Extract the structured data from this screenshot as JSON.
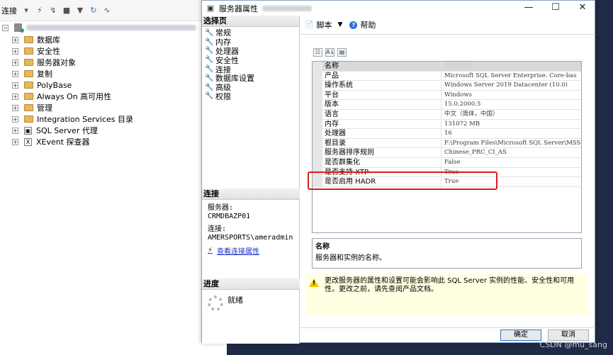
{
  "object_explorer": {
    "toolbar_label": "连接",
    "tree": [
      {
        "label": "数据库"
      },
      {
        "label": "安全性"
      },
      {
        "label": "服务器对象"
      },
      {
        "label": "复制"
      },
      {
        "label": "PolyBase"
      },
      {
        "label": "Always On 高可用性"
      },
      {
        "label": "管理"
      },
      {
        "label": "Integration Services 目录"
      },
      {
        "label": "SQL Server 代理"
      },
      {
        "label": "XEvent 探查器"
      }
    ]
  },
  "dialog": {
    "title": "服务器属性",
    "page_section_title": "选择页",
    "pages": [
      "常规",
      "内存",
      "处理器",
      "安全性",
      "连接",
      "数据库设置",
      "高级",
      "权限"
    ],
    "connection": {
      "section_title": "连接",
      "server_label": "服务器:",
      "server_value": "CRMDBAZP01",
      "connect_label": "连接:",
      "connect_value": "AMERSPORTS\\ameradmin",
      "link_text": "查看连接属性"
    },
    "progress": {
      "section_title": "进度",
      "status": "就绪"
    },
    "toolbar": {
      "script_label": "脚本",
      "help_label": "帮助"
    },
    "properties": {
      "header_name": "名称",
      "rows": [
        {
          "name": "产品",
          "value": "Microsoft SQL Server Enterprise: Core-bas"
        },
        {
          "name": "操作系统",
          "value": "Windows Server 2019 Datacenter (10.0)"
        },
        {
          "name": "平台",
          "value": "Windows"
        },
        {
          "name": "版本",
          "value": "15.0.2000.5"
        },
        {
          "name": "语言",
          "value": "中文（简体，中国）"
        },
        {
          "name": "内存",
          "value": "131072 MB"
        },
        {
          "name": "处理器",
          "value": "16"
        },
        {
          "name": "根目录",
          "value": "F:\\Program Files\\Microsoft SQL Server\\MSS"
        },
        {
          "name": "服务器排序规则",
          "value": "Chinese_PRC_CI_AS"
        },
        {
          "name": "是否群集化",
          "value": "False"
        },
        {
          "name": "是否支持 XTP",
          "value": "True"
        },
        {
          "name": "是否启用 HADR",
          "value": "True"
        }
      ]
    },
    "description": {
      "name": "名称",
      "text": "服务器和实例的名称。"
    },
    "warning": "更改服务器的属性和设置可能会影响此 SQL Server 实例的性能、安全性和可用性。更改之前，请先查阅产品文档。",
    "ok_label": "确定",
    "cancel_label": "取消"
  },
  "watermark": "CSDN @mu_sang"
}
